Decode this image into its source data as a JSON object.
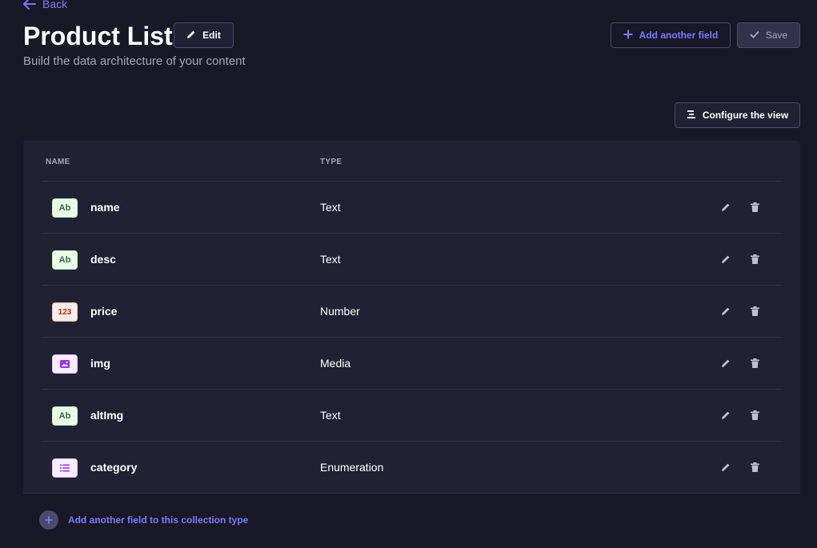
{
  "header": {
    "back_label": "Back",
    "title": "Product List",
    "subtitle": "Build the data architecture of your content",
    "edit_label": "Edit",
    "add_field_label": "Add another field",
    "save_label": "Save",
    "configure_label": "Configure the view"
  },
  "table": {
    "columns": {
      "name": "NAME",
      "type": "TYPE"
    },
    "rows": [
      {
        "badge": "Ab",
        "badge_kind": "text",
        "name": "name",
        "type": "Text"
      },
      {
        "badge": "Ab",
        "badge_kind": "text",
        "name": "desc",
        "type": "Text"
      },
      {
        "badge": "123",
        "badge_kind": "number",
        "name": "price",
        "type": "Number"
      },
      {
        "badge": "",
        "badge_kind": "media",
        "name": "img",
        "type": "Media"
      },
      {
        "badge": "Ab",
        "badge_kind": "text",
        "name": "altImg",
        "type": "Text"
      },
      {
        "badge": "",
        "badge_kind": "enum",
        "name": "category",
        "type": "Enumeration"
      }
    ],
    "row_actions": {
      "edit_icon": "pencil-icon",
      "delete_icon": "trash-icon"
    },
    "footer_add_label": "Add another field to this collection type"
  },
  "colors": {
    "background": "#181826",
    "surface": "#212134",
    "accent": "#7b79ff",
    "muted_text": "#a5a5ba"
  }
}
